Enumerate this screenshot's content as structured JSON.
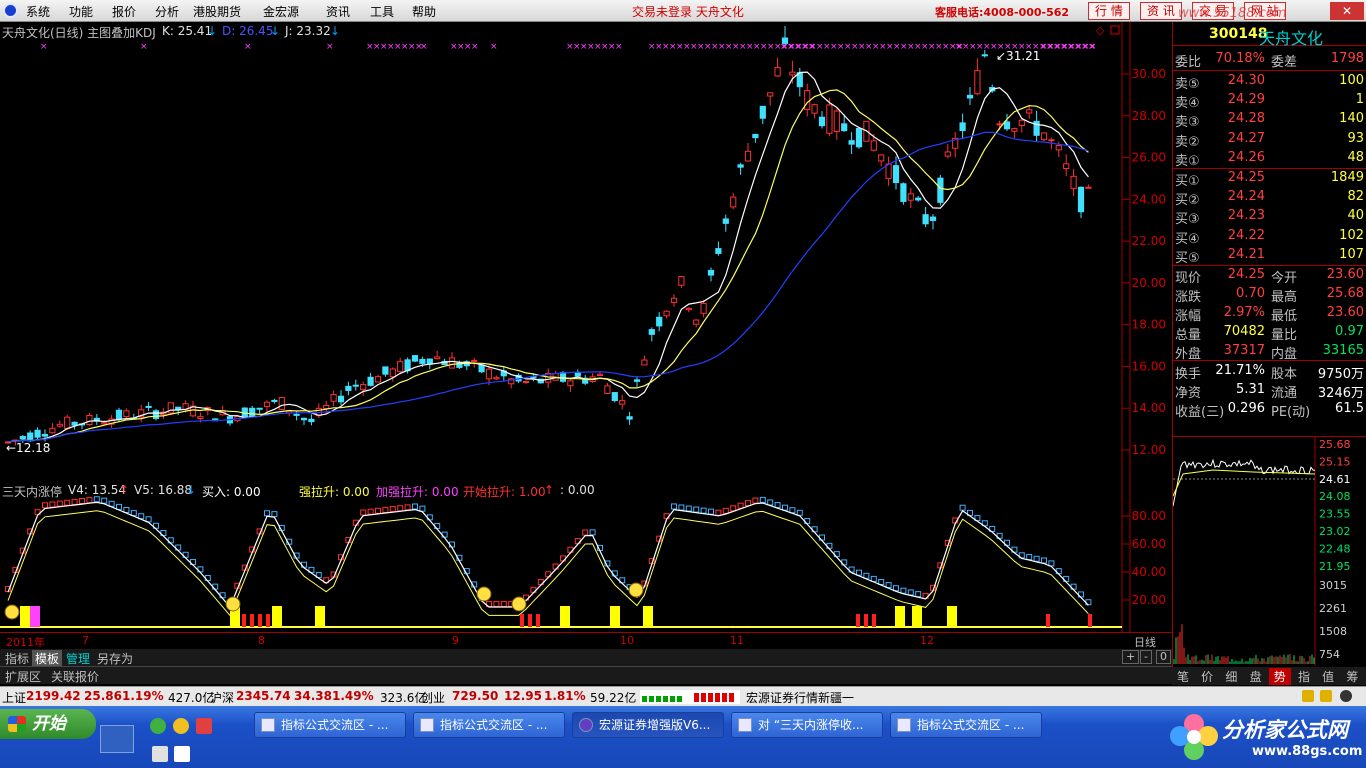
{
  "menu": {
    "items": [
      "系统",
      "功能",
      "报价",
      "分析",
      "港股期货",
      "金宏源",
      "资讯",
      "工具",
      "帮助"
    ],
    "login_status": "交易未登录  天舟文化",
    "hotline": "客服电话:4008-000-562",
    "right_buttons": [
      "行 情",
      "资 讯",
      "交 易",
      "网 站"
    ],
    "watermark": "www.55188.com"
  },
  "main_chart": {
    "header": {
      "title": "天舟文化(日线) 主图叠加KDJ",
      "k_label": "K: 25.41",
      "d_label": "D: 26.45",
      "j_label": "J: 23.32",
      "arrow_down": "↓"
    },
    "y_ticks": [
      "30.00",
      "28.00",
      "26.00",
      "24.00",
      "22.00",
      "20.00",
      "18.00",
      "16.00",
      "14.00",
      "12.00"
    ],
    "high_marker": "31.21",
    "low_marker": "12.18"
  },
  "sub_chart": {
    "header": {
      "title": "三天内涨停",
      "v4": "V4: 13.54",
      "v5": "V5: 16.88",
      "buy": "买入: 0.00",
      "strong": "强拉升: 0.00",
      "add_strong": "加强拉升: 0.00",
      "start": "开始拉升: 1.00",
      "extra": ": 0.00",
      "arrow_up": "↑",
      "arrow_down": "↓"
    },
    "y_ticks": [
      "80.00",
      "60.00",
      "40.00",
      "20.00"
    ]
  },
  "x_axis": {
    "labels": [
      "2011年",
      "7",
      "8",
      "9",
      "10",
      "11",
      "12"
    ],
    "tab_right": "日线"
  },
  "bottom_tabs": {
    "row1": [
      "指标",
      "模板",
      "管理",
      "另存为"
    ],
    "row2": [
      "扩展区",
      "关联报价"
    ],
    "zoom": [
      "+",
      "-",
      "0"
    ]
  },
  "quote": {
    "code": "300148",
    "name": "天舟文化",
    "wei_bi_label": "委比",
    "wei_bi": "70.18%",
    "wei_cha_label": "委差",
    "wei_cha": "1798",
    "asks": [
      {
        "label": "卖⑤",
        "price": "24.30",
        "vol": "100"
      },
      {
        "label": "卖④",
        "price": "24.29",
        "vol": "1"
      },
      {
        "label": "卖③",
        "price": "24.28",
        "vol": "140"
      },
      {
        "label": "卖②",
        "price": "24.27",
        "vol": "93"
      },
      {
        "label": "卖①",
        "price": "24.26",
        "vol": "48"
      }
    ],
    "bids": [
      {
        "label": "买①",
        "price": "24.25",
        "vol": "1849"
      },
      {
        "label": "买②",
        "price": "24.24",
        "vol": "82"
      },
      {
        "label": "买③",
        "price": "24.23",
        "vol": "40"
      },
      {
        "label": "买④",
        "price": "24.22",
        "vol": "102"
      },
      {
        "label": "买⑤",
        "price": "24.21",
        "vol": "107"
      }
    ],
    "stats": [
      {
        "l1": "现价",
        "v1": "24.25",
        "c1": "red",
        "l2": "今开",
        "v2": "23.60",
        "c2": "red"
      },
      {
        "l1": "涨跌",
        "v1": "0.70",
        "c1": "red",
        "l2": "最高",
        "v2": "25.68",
        "c2": "red"
      },
      {
        "l1": "涨幅",
        "v1": "2.97%",
        "c1": "red",
        "l2": "最低",
        "v2": "23.60",
        "c2": "red"
      },
      {
        "l1": "总量",
        "v1": "70482",
        "c1": "yellow",
        "l2": "量比",
        "v2": "0.97",
        "c2": "green"
      },
      {
        "l1": "外盘",
        "v1": "37317",
        "c1": "red",
        "l2": "内盘",
        "v2": "33165",
        "c2": "green"
      }
    ],
    "stats2": [
      {
        "l1": "换手",
        "v1": "21.71%",
        "l2": "股本",
        "v2": "9750万"
      },
      {
        "l1": "净资",
        "v1": "5.31",
        "l2": "流通",
        "v2": "3246万"
      },
      {
        "l1": "收益(三)",
        "v1": "0.296",
        "l2": "PE(动)",
        "v2": "61.5"
      }
    ],
    "mini_prices": [
      "25.68",
      "25.15",
      "24.61",
      "24.08",
      "23.55",
      "23.02",
      "22.48",
      "21.95"
    ],
    "mini_vols": [
      "3015",
      "2261",
      "1508",
      "754"
    ],
    "side_tabs": [
      "笔",
      "价",
      "细",
      "盘",
      "势",
      "指",
      "值",
      "筹"
    ]
  },
  "statusbar": {
    "sh_label": "上证",
    "sh_val": "2199.42",
    "sh_chg": "25.86",
    "sh_pct": "1.19%",
    "sh_amt": "427.0亿",
    "hs_label": "沪深",
    "hs_val": "2345.74",
    "hs_chg": "34.38",
    "hs_pct": "1.49%",
    "hs_amt": "323.6亿",
    "cy_label": "创业",
    "cy_val": "729.50",
    "cy_chg": "12.95",
    "cy_pct": "1.81%",
    "cy_amt": "59.22亿",
    "news": "宏源证券行情新疆一"
  },
  "taskbar": {
    "start": "开始",
    "buttons": [
      "指标公式交流区 - ...",
      "指标公式交流区 - ...",
      "宏源证券增强版V6...",
      "对 “三天内涨停收...",
      "指标公式交流区 - ..."
    ],
    "brand_title": "分析家公式网",
    "brand_url": "www.88gs.com"
  }
}
